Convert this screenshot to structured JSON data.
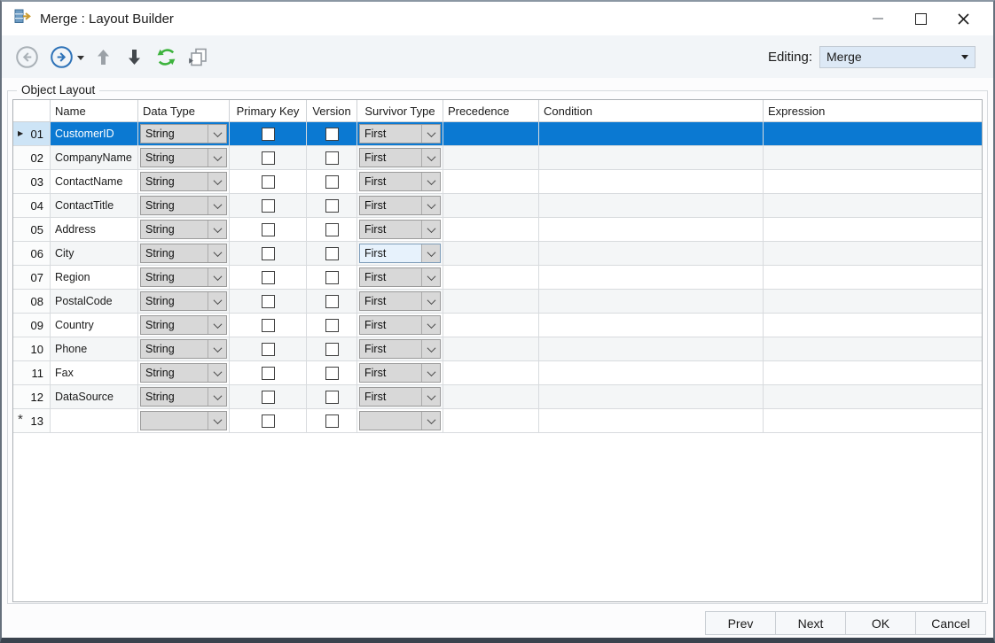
{
  "window": {
    "title": "Merge : Layout Builder"
  },
  "window_controls": {
    "icons": [
      "minimize-icon",
      "maximize-icon",
      "close-icon"
    ]
  },
  "toolbar": {
    "icons": [
      {
        "name": "back-icon",
        "enabled": false
      },
      {
        "name": "forward-icon",
        "enabled": true,
        "has_dropdown": true
      },
      {
        "name": "move-up-icon",
        "enabled": false
      },
      {
        "name": "move-down-icon",
        "enabled": true
      },
      {
        "name": "refresh-icon",
        "enabled": true
      },
      {
        "name": "copy-layout-icon",
        "enabled": false
      }
    ],
    "editing_label": "Editing:",
    "editing_value": "Merge"
  },
  "group": {
    "title": "Object Layout"
  },
  "grid": {
    "columns": [
      "",
      "Name",
      "Data Type",
      "Primary Key",
      "Version",
      "Survivor Type",
      "Precedence",
      "Condition",
      "Expression"
    ],
    "focused_cell": {
      "row": "06",
      "column": "Survivor Type"
    },
    "rows": [
      {
        "num": "01",
        "name": "CustomerID",
        "data_type": "String",
        "primary_key": false,
        "version": false,
        "survivor_type": "First",
        "precedence": "",
        "condition": "",
        "expression": "",
        "selected": true,
        "new_row": false
      },
      {
        "num": "02",
        "name": "CompanyName",
        "data_type": "String",
        "primary_key": false,
        "version": false,
        "survivor_type": "First",
        "precedence": "",
        "condition": "",
        "expression": "",
        "selected": false,
        "new_row": false
      },
      {
        "num": "03",
        "name": "ContactName",
        "data_type": "String",
        "primary_key": false,
        "version": false,
        "survivor_type": "First",
        "precedence": "",
        "condition": "",
        "expression": "",
        "selected": false,
        "new_row": false
      },
      {
        "num": "04",
        "name": "ContactTitle",
        "data_type": "String",
        "primary_key": false,
        "version": false,
        "survivor_type": "First",
        "precedence": "",
        "condition": "",
        "expression": "",
        "selected": false,
        "new_row": false
      },
      {
        "num": "05",
        "name": "Address",
        "data_type": "String",
        "primary_key": false,
        "version": false,
        "survivor_type": "First",
        "precedence": "",
        "condition": "",
        "expression": "",
        "selected": false,
        "new_row": false
      },
      {
        "num": "06",
        "name": "City",
        "data_type": "String",
        "primary_key": false,
        "version": false,
        "survivor_type": "First",
        "precedence": "",
        "condition": "",
        "expression": "",
        "selected": false,
        "new_row": false
      },
      {
        "num": "07",
        "name": "Region",
        "data_type": "String",
        "primary_key": false,
        "version": false,
        "survivor_type": "First",
        "precedence": "",
        "condition": "",
        "expression": "",
        "selected": false,
        "new_row": false
      },
      {
        "num": "08",
        "name": "PostalCode",
        "data_type": "String",
        "primary_key": false,
        "version": false,
        "survivor_type": "First",
        "precedence": "",
        "condition": "",
        "expression": "",
        "selected": false,
        "new_row": false
      },
      {
        "num": "09",
        "name": "Country",
        "data_type": "String",
        "primary_key": false,
        "version": false,
        "survivor_type": "First",
        "precedence": "",
        "condition": "",
        "expression": "",
        "selected": false,
        "new_row": false
      },
      {
        "num": "10",
        "name": "Phone",
        "data_type": "String",
        "primary_key": false,
        "version": false,
        "survivor_type": "First",
        "precedence": "",
        "condition": "",
        "expression": "",
        "selected": false,
        "new_row": false
      },
      {
        "num": "11",
        "name": "Fax",
        "data_type": "String",
        "primary_key": false,
        "version": false,
        "survivor_type": "First",
        "precedence": "",
        "condition": "",
        "expression": "",
        "selected": false,
        "new_row": false
      },
      {
        "num": "12",
        "name": "DataSource",
        "data_type": "String",
        "primary_key": false,
        "version": false,
        "survivor_type": "First",
        "precedence": "",
        "condition": "",
        "expression": "",
        "selected": false,
        "new_row": false
      },
      {
        "num": "13",
        "name": "",
        "data_type": "",
        "primary_key": false,
        "version": false,
        "survivor_type": "",
        "precedence": "",
        "condition": "",
        "expression": "",
        "selected": false,
        "new_row": true
      }
    ]
  },
  "footer": {
    "buttons": [
      "Prev",
      "Next",
      "OK",
      "Cancel"
    ]
  },
  "colors": {
    "selection_blue": "#0b79d2",
    "selected_row_header": "#cde4f6",
    "toolbar_bg": "#f2f5f8",
    "combo_bg": "#d8d8d8",
    "focused_cell_bg": "#e7f2fc",
    "editing_combo_bg": "#dde9f6",
    "refresh_green": "#3db33d",
    "forward_blue": "#2f73b8"
  }
}
